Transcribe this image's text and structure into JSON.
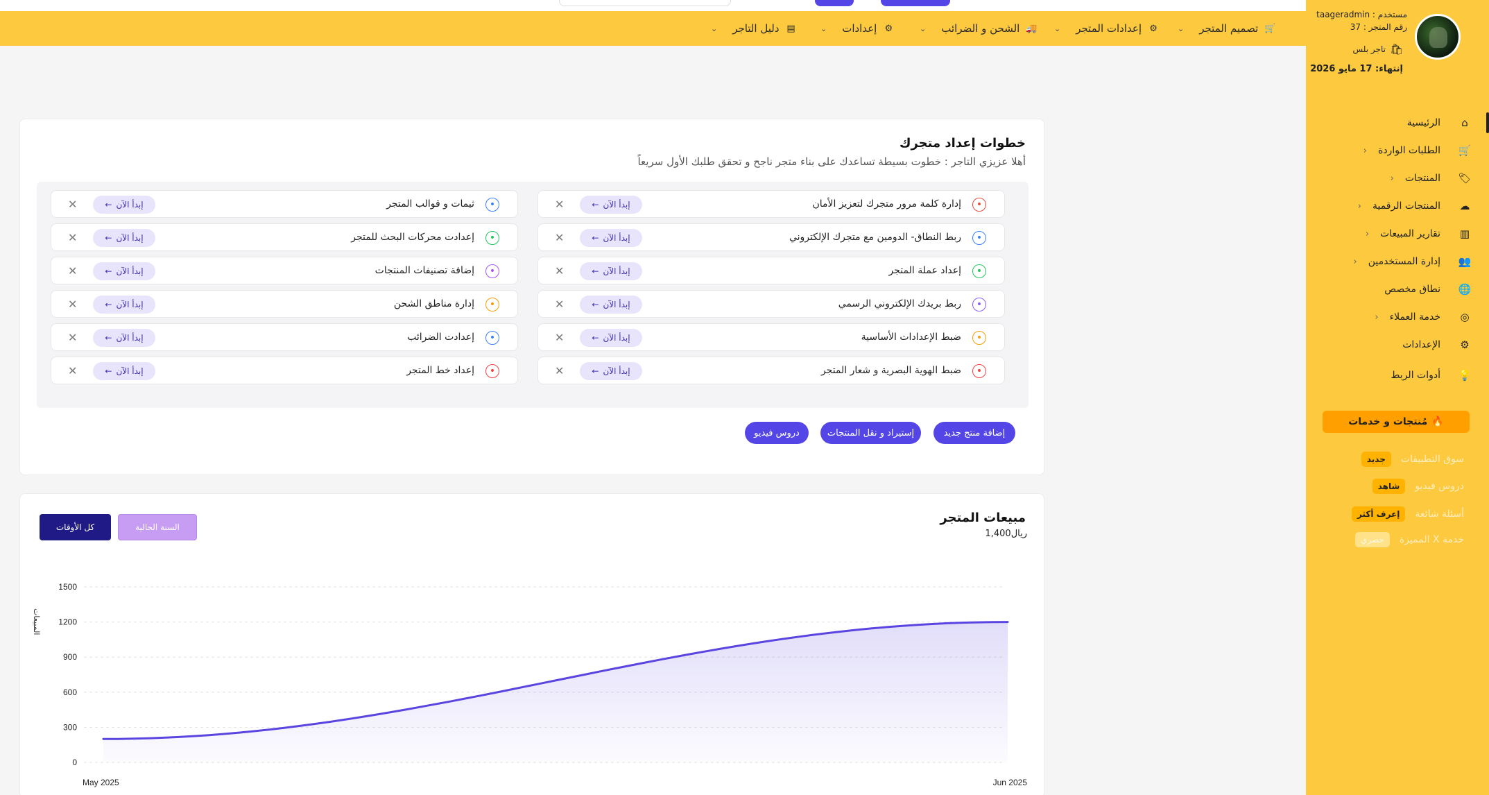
{
  "topnav": {
    "items": [
      {
        "label": "تصميم المتجر",
        "icon": "cart-icon"
      },
      {
        "label": "إعدادات المتجر",
        "icon": "store-settings-icon"
      },
      {
        "label": "الشحن و الضرائب",
        "icon": "truck-icon"
      },
      {
        "label": "إعدادات",
        "icon": "gear-icon"
      },
      {
        "label": "دليل التاجر",
        "icon": "book-icon"
      }
    ]
  },
  "user": {
    "username": "مستخدم : taageradmin",
    "store_number": "رقم المتجر : 37",
    "plan": "تاجر بلس",
    "expiry": "إنتهاء: 17 مايو 2026"
  },
  "sidebar": {
    "items": [
      {
        "label": "الرئيسية",
        "icon": "home-icon",
        "active": true,
        "chevron": false
      },
      {
        "label": "الطلبات الواردة",
        "icon": "cart-in-icon",
        "chevron": true
      },
      {
        "label": "المنتجات",
        "icon": "tag-icon",
        "chevron": true
      },
      {
        "label": "المنتجات الرقمية",
        "icon": "cloud-download-icon",
        "chevron": true
      },
      {
        "label": "تقارير المبيعات",
        "icon": "bar-chart-icon",
        "chevron": true
      },
      {
        "label": "إدارة المستخدمين",
        "icon": "users-icon",
        "chevron": true
      },
      {
        "label": "نطاق مخصص",
        "icon": "globe-icon",
        "chevron": false
      },
      {
        "label": "خدمة العملاء",
        "icon": "support-icon",
        "chevron": true
      },
      {
        "label": "الإعدادات",
        "icon": "gears-icon",
        "chevron": false
      },
      {
        "label": "أدوات الربط",
        "icon": "bulb-icon",
        "chevron": false
      }
    ],
    "promo_label": "مُنتجات و خدمات",
    "extras": [
      {
        "label": "سوق التطبيقات",
        "tag": "جديد"
      },
      {
        "label": "دروس فيديو",
        "tag": "شاهد"
      },
      {
        "label": "أسئلة شائعة",
        "tag": "إعرف أكثر"
      },
      {
        "label": "خدمة X المميزة",
        "tag": "حصري"
      }
    ]
  },
  "setup": {
    "title": "خطوات إعداد متجرك",
    "subtitle": "أهلا عزيزي التاجر : خطوت بسيطة تساعدك على بناء متجر ناجح و تحقق طلبك الأول سريعاً",
    "start_label": "إبدأ الآن",
    "right_steps": [
      {
        "label": "إدارة كلمة مرور متجرك لتعزيز الأمان",
        "icon": "key-icon",
        "color": "#e74c3c"
      },
      {
        "label": "ربط النطاق- الدومين مع متجرك الإلكتروني",
        "icon": "globe-icon",
        "color": "#3b82f6"
      },
      {
        "label": "إعداد عملة المتجر",
        "icon": "wallet-icon",
        "color": "#22c55e"
      },
      {
        "label": "ربط بريدك الإلكتروني الرسمي",
        "icon": "mail-icon",
        "color": "#8b5cf6"
      },
      {
        "label": "ضبط الإعدادات الأساسية",
        "icon": "settings-icon",
        "color": "#f59e0b"
      },
      {
        "label": "ضبط الهوية البصرية و شعار المتجر",
        "icon": "badge-icon",
        "color": "#ef4444"
      }
    ],
    "left_steps": [
      {
        "label": "ثيمات و قوالب المتجر",
        "icon": "palette-icon",
        "color": "#3b82f6"
      },
      {
        "label": "إعدادت محركات البحث للمتجر",
        "icon": "seo-icon",
        "color": "#22c55e"
      },
      {
        "label": "إضافة تصنيفات المنتجات",
        "icon": "tag-icon",
        "color": "#a855f7"
      },
      {
        "label": "إدارة مناطق الشحن",
        "icon": "map-icon",
        "color": "#f59e0b"
      },
      {
        "label": "إعدادت الضرائب",
        "icon": "invoice-icon",
        "color": "#3b82f6"
      },
      {
        "label": "إعداد خط المتجر",
        "icon": "font-icon",
        "color": "#ef4444"
      }
    ],
    "actions": [
      "إضافة منتج جديد",
      "إستيراد و نقل المنتجات",
      "دروس فيديو"
    ]
  },
  "sales": {
    "title": "مبيعات المتجر",
    "total": "ريال1,400",
    "btn_current_year": "السنة الحالية",
    "btn_all_time": "كل الأوقات",
    "accent": "#5b45e0"
  },
  "chart_data": {
    "type": "area",
    "x": [
      "May 2025",
      "Jun 2025"
    ],
    "series": [
      {
        "values": [
          200,
          1200
        ]
      }
    ],
    "ylabel": "المبيعات",
    "yticks": [
      0,
      300,
      600,
      900,
      1200,
      1500
    ],
    "ylim": [
      0,
      1500
    ],
    "grid": true
  }
}
